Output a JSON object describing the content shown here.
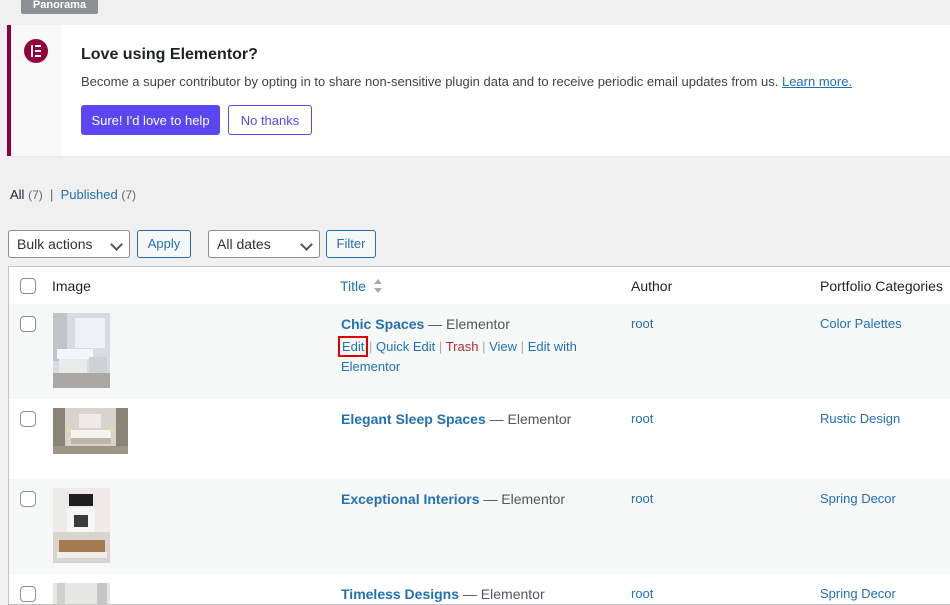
{
  "top_tab": "Panorama",
  "notice": {
    "title": "Love using Elementor?",
    "text": "Become a super contributor by opting in to share non-sensitive plugin data and to receive periodic email updates from us.",
    "learn_more": "Learn more.",
    "primary_button": "Sure! I'd love to help",
    "secondary_button": "No thanks"
  },
  "filters": {
    "all_label": "All",
    "all_count": "(7)",
    "separator": "|",
    "published_label": "Published",
    "published_count": "(7)"
  },
  "toolbar": {
    "bulk_actions": "Bulk actions",
    "apply": "Apply",
    "dates": "All dates",
    "filter": "Filter"
  },
  "table": {
    "headers": {
      "image": "Image",
      "title": "Title",
      "author": "Author",
      "categories": "Portfolio Categories"
    },
    "rows": [
      {
        "title": "Chic Spaces",
        "suffix": " — Elementor",
        "author": "root",
        "category": "Color Palettes"
      },
      {
        "title": "Elegant Sleep Spaces",
        "suffix": " — Elementor",
        "author": "root",
        "category": "Rustic Design"
      },
      {
        "title": "Exceptional Interiors",
        "suffix": " — Elementor",
        "author": "root",
        "category": "Spring Decor"
      },
      {
        "title": "Timeless Designs",
        "suffix": " — Elementor",
        "author": "root",
        "category": "Spring Decor"
      }
    ],
    "row_actions": {
      "edit": "Edit",
      "quick_edit": "Quick Edit",
      "trash": "Trash",
      "view": "View",
      "edit_with_elementor": "Edit with Elementor",
      "sep": "|"
    }
  },
  "colors": {
    "elementor_brand": "#92003b",
    "primary_button": "#5a47f2",
    "link": "#2271b1",
    "trash": "#b32d2e",
    "highlight_box": "#e00000"
  }
}
